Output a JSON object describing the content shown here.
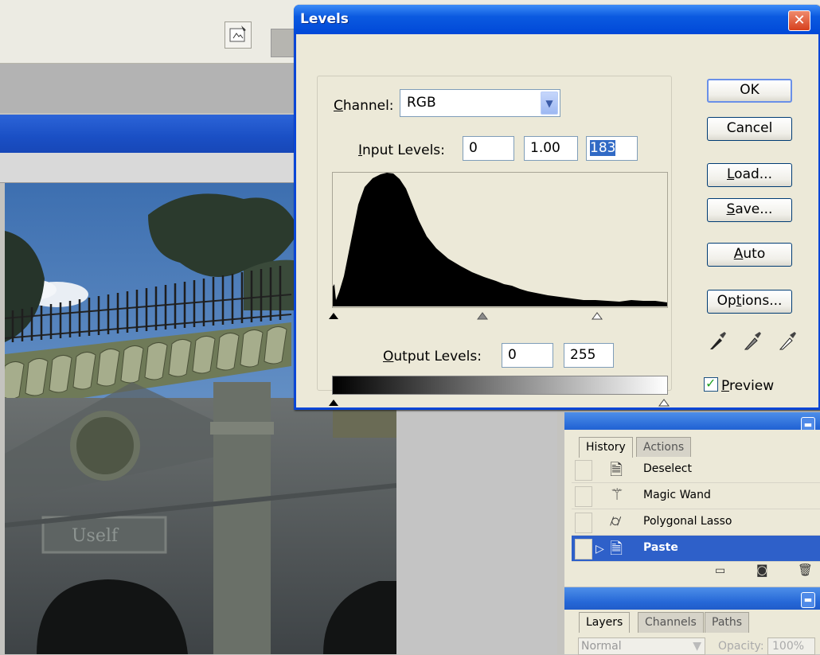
{
  "dialog": {
    "title": "Levels",
    "channel_label_pre": "",
    "channel_label_u": "C",
    "channel_label_post": "hannel:",
    "channel_value": "RGB",
    "input_levels_u": "I",
    "input_levels_post": "nput Levels:",
    "input_black": "0",
    "input_gamma": "1.00",
    "input_white": "183",
    "output_levels_u": "O",
    "output_levels_post": "utput Levels:",
    "output_black": "0",
    "output_white": "255",
    "buttons": {
      "ok": "OK",
      "cancel": "Cancel",
      "load_u": "L",
      "load_post": "oad...",
      "save_u": "S",
      "save_post": "ave...",
      "auto_u": "A",
      "auto_post": "uto",
      "options_pre": "Op",
      "options_u": "t",
      "options_post": "ions..."
    },
    "preview_u": "P",
    "preview_post": "review",
    "preview_checked": true,
    "icons": [
      "close-icon",
      "black-eyedropper-icon",
      "gray-eyedropper-icon",
      "white-eyedropper-icon"
    ]
  },
  "history_panel": {
    "tabs": [
      "History",
      "Actions"
    ],
    "items": [
      {
        "label": "Deselect",
        "icon": "document-icon",
        "selected": false
      },
      {
        "label": "Magic Wand",
        "icon": "magic-wand-icon",
        "selected": false
      },
      {
        "label": "Polygonal Lasso",
        "icon": "lasso-icon",
        "selected": false
      },
      {
        "label": "Paste",
        "icon": "document-icon",
        "selected": true
      }
    ]
  },
  "layers_panel": {
    "tabs": [
      "Layers",
      "Channels",
      "Paths"
    ],
    "blend_mode": "Normal",
    "opacity_label": "Opacity:",
    "opacity_value": "100%"
  },
  "colors": {
    "titlebar": "#0b5ae0",
    "dialog_bg": "#ece9d8",
    "history_selected": "#2e60c9"
  }
}
